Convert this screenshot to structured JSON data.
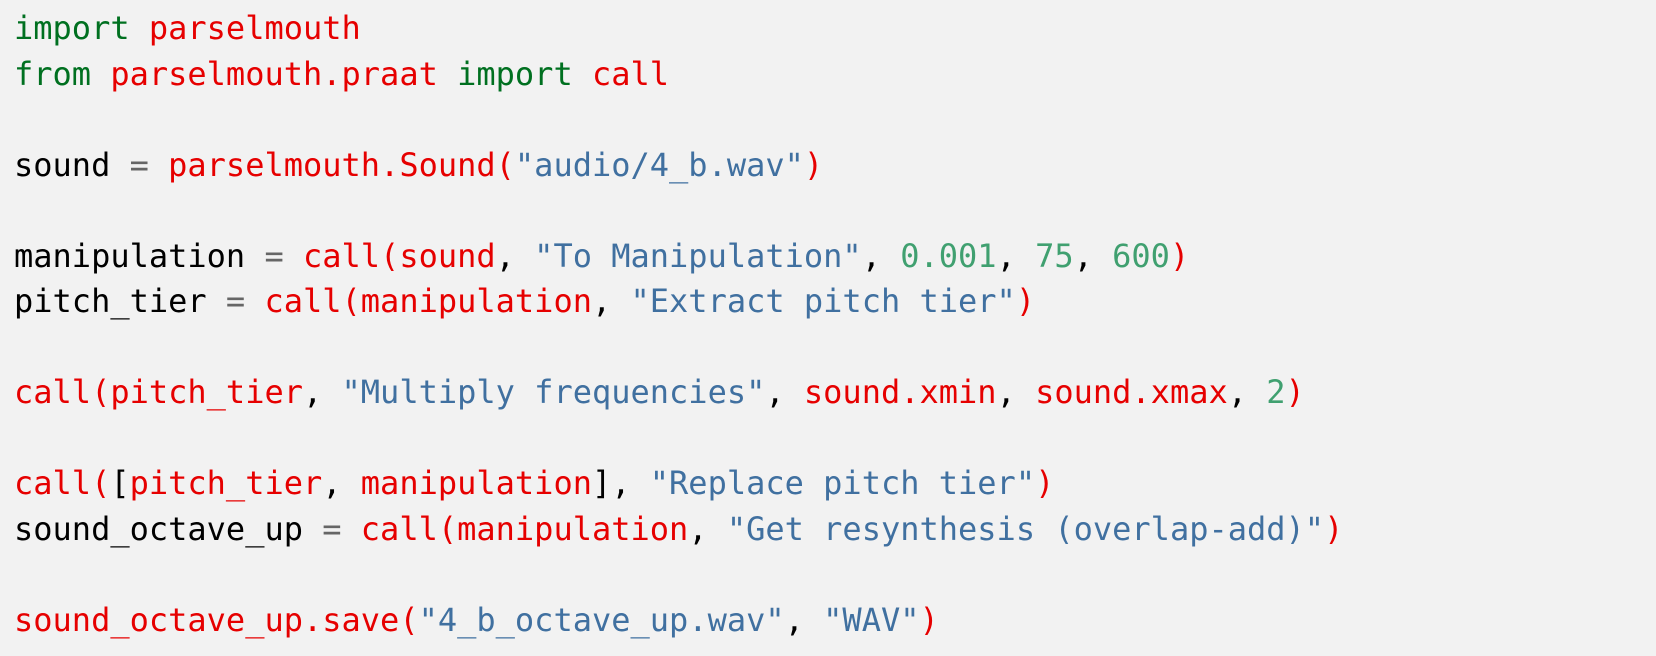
{
  "colors": {
    "background": "#f2f2f2",
    "keyword": "#007020",
    "name": "#e60000",
    "string": "#4070a0",
    "number": "#40a070",
    "operator": "#666666",
    "plain": "#000000"
  },
  "code": {
    "lines": [
      [
        {
          "t": "keyword",
          "v": "import"
        },
        {
          "t": "plain",
          "v": " "
        },
        {
          "t": "name",
          "v": "parselmouth"
        }
      ],
      [
        {
          "t": "keyword",
          "v": "from"
        },
        {
          "t": "plain",
          "v": " "
        },
        {
          "t": "name",
          "v": "parselmouth.praat"
        },
        {
          "t": "plain",
          "v": " "
        },
        {
          "t": "keyword",
          "v": "import"
        },
        {
          "t": "plain",
          "v": " "
        },
        {
          "t": "name",
          "v": "call"
        }
      ],
      [],
      [
        {
          "t": "plain",
          "v": "sound"
        },
        {
          "t": "op",
          "v": " = "
        },
        {
          "t": "name",
          "v": "parselmouth.Sound("
        },
        {
          "t": "string",
          "v": "\"audio/4_b.wav\""
        },
        {
          "t": "name",
          "v": ")"
        }
      ],
      [],
      [
        {
          "t": "plain",
          "v": "manipulation"
        },
        {
          "t": "op",
          "v": " = "
        },
        {
          "t": "name",
          "v": "call(sound"
        },
        {
          "t": "plain",
          "v": ", "
        },
        {
          "t": "string",
          "v": "\"To Manipulation\""
        },
        {
          "t": "plain",
          "v": ", "
        },
        {
          "t": "number",
          "v": "0.001"
        },
        {
          "t": "plain",
          "v": ", "
        },
        {
          "t": "number",
          "v": "75"
        },
        {
          "t": "plain",
          "v": ", "
        },
        {
          "t": "number",
          "v": "600"
        },
        {
          "t": "name",
          "v": ")"
        }
      ],
      [
        {
          "t": "plain",
          "v": "pitch_tier"
        },
        {
          "t": "op",
          "v": " = "
        },
        {
          "t": "name",
          "v": "call(manipulation"
        },
        {
          "t": "plain",
          "v": ", "
        },
        {
          "t": "string",
          "v": "\"Extract pitch tier\""
        },
        {
          "t": "name",
          "v": ")"
        }
      ],
      [],
      [
        {
          "t": "name",
          "v": "call(pitch_tier"
        },
        {
          "t": "plain",
          "v": ", "
        },
        {
          "t": "string",
          "v": "\"Multiply frequencies\""
        },
        {
          "t": "plain",
          "v": ", "
        },
        {
          "t": "name",
          "v": "sound.xmin"
        },
        {
          "t": "plain",
          "v": ", "
        },
        {
          "t": "name",
          "v": "sound.xmax"
        },
        {
          "t": "plain",
          "v": ", "
        },
        {
          "t": "number",
          "v": "2"
        },
        {
          "t": "name",
          "v": ")"
        }
      ],
      [],
      [
        {
          "t": "name",
          "v": "call("
        },
        {
          "t": "plain",
          "v": "["
        },
        {
          "t": "name",
          "v": "pitch_tier"
        },
        {
          "t": "plain",
          "v": ", "
        },
        {
          "t": "name",
          "v": "manipulation"
        },
        {
          "t": "plain",
          "v": "], "
        },
        {
          "t": "string",
          "v": "\"Replace pitch tier\""
        },
        {
          "t": "name",
          "v": ")"
        }
      ],
      [
        {
          "t": "plain",
          "v": "sound_octave_up"
        },
        {
          "t": "op",
          "v": " = "
        },
        {
          "t": "name",
          "v": "call(manipulation"
        },
        {
          "t": "plain",
          "v": ", "
        },
        {
          "t": "string",
          "v": "\"Get resynthesis (overlap-add)\""
        },
        {
          "t": "name",
          "v": ")"
        }
      ],
      [],
      [
        {
          "t": "name",
          "v": "sound_octave_up.save("
        },
        {
          "t": "string",
          "v": "\"4_b_octave_up.wav\""
        },
        {
          "t": "plain",
          "v": ", "
        },
        {
          "t": "string",
          "v": "\"WAV\""
        },
        {
          "t": "name",
          "v": ")"
        }
      ]
    ]
  }
}
